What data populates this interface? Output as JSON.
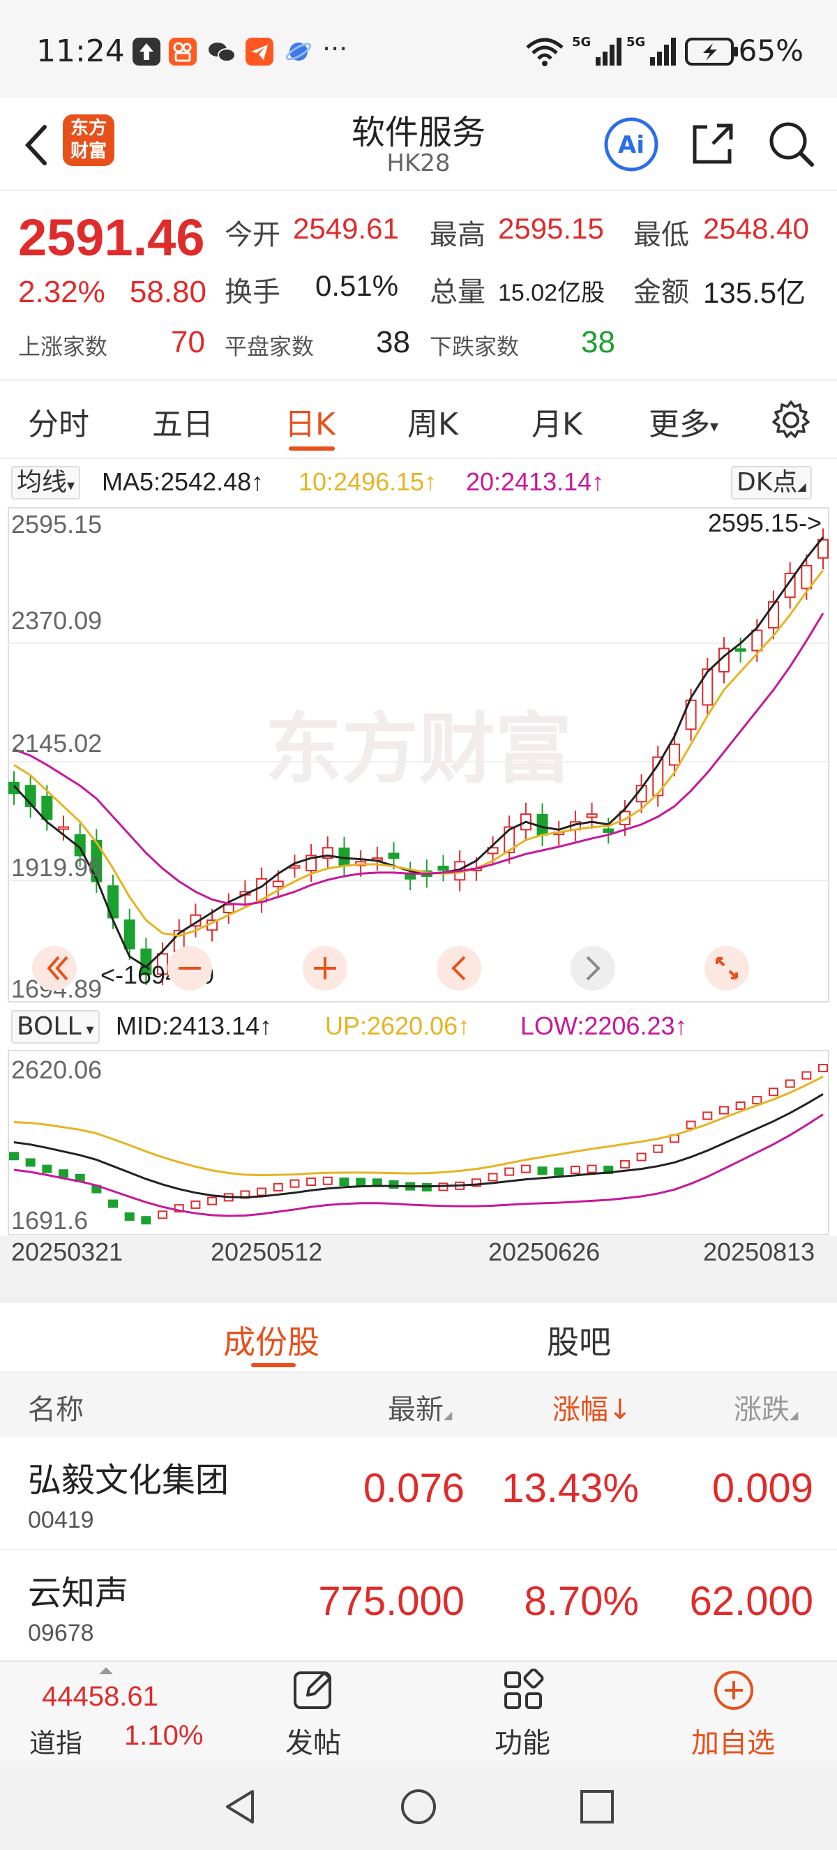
{
  "status": {
    "time": "11:24",
    "right_text": "65%",
    "more": "···"
  },
  "header": {
    "brand": "东方财富",
    "brand_line1": "东方",
    "brand_line2": "财富",
    "title": "软件服务",
    "subtitle": "HK28",
    "ai_label": "Ai"
  },
  "quote": {
    "price": "2591.46",
    "change_pct": "2.32%",
    "change_amt": "58.80",
    "open_label": "今开",
    "open": "2549.61",
    "high_label": "最高",
    "high": "2595.15",
    "low_label": "最低",
    "low": "2548.40",
    "turnover_label": "换手",
    "turnover": "0.51%",
    "volume_label": "总量",
    "volume": "15.02亿股",
    "amount_label": "金额",
    "amount": "135.5亿",
    "up_label": "上涨家数",
    "up_count": "70",
    "flat_label": "平盘家数",
    "flat_count": "38",
    "down_label": "下跌家数",
    "down_count": "38"
  },
  "tabs": [
    "分时",
    "五日",
    "日K",
    "周K",
    "月K",
    "更多"
  ],
  "active_tab": "日K",
  "ma": {
    "selector": "均线",
    "ma5": "MA5:2542.48↑",
    "ma10": "10:2496.15↑",
    "ma20": "20:2413.14↑",
    "dk_button": "DK点"
  },
  "colors": {
    "up": "#e02b2b",
    "down": "#1aa12e",
    "accent": "#e8501b",
    "ma5": "#222222",
    "ma10": "#e6b422",
    "ma20": "#c8179a"
  },
  "chart_data": [
    {
      "type": "candlestick",
      "y_ticks": [
        "2595.15",
        "2370.09",
        "2145.02",
        "1919.96",
        "1694.89"
      ],
      "ylim": [
        1694.89,
        2595.15
      ],
      "max_marker": "2595.15->",
      "min_marker": "<-1694.89",
      "watermark": "东方财富",
      "series": [
        {
          "name": "MA5",
          "values": [
            2080,
            2045,
            2010,
            1985,
            1960,
            1900,
            1820,
            1750,
            1730,
            1760,
            1795,
            1815,
            1835,
            1855,
            1870,
            1885,
            1910,
            1930,
            1940,
            1945,
            1940,
            1938,
            1935,
            1925,
            1915,
            1910,
            1912,
            1918,
            1935,
            1965,
            1995,
            2010,
            2000,
            1995,
            2005,
            2010,
            2005,
            2035,
            2075,
            2120,
            2175,
            2250,
            2300,
            2330,
            2355,
            2385,
            2430,
            2475,
            2520,
            2560
          ]
        },
        {
          "name": "10",
          "values": [
            2120,
            2100,
            2070,
            2040,
            2010,
            1970,
            1920,
            1865,
            1820,
            1795,
            1790,
            1800,
            1815,
            1830,
            1845,
            1860,
            1878,
            1895,
            1910,
            1920,
            1925,
            1928,
            1928,
            1924,
            1918,
            1912,
            1910,
            1912,
            1920,
            1935,
            1955,
            1975,
            1985,
            1990,
            1995,
            2000,
            2002,
            2015,
            2035,
            2065,
            2105,
            2160,
            2215,
            2265,
            2300,
            2335,
            2370,
            2410,
            2455,
            2496
          ]
        },
        {
          "name": "20",
          "values": [
            2150,
            2138,
            2120,
            2100,
            2080,
            2055,
            2020,
            1985,
            1950,
            1920,
            1895,
            1875,
            1860,
            1852,
            1850,
            1855,
            1865,
            1875,
            1888,
            1898,
            1905,
            1910,
            1912,
            1912,
            1910,
            1910,
            1912,
            1915,
            1920,
            1928,
            1938,
            1948,
            1955,
            1962,
            1970,
            1978,
            1985,
            1995,
            2005,
            2020,
            2040,
            2070,
            2105,
            2145,
            2185,
            2225,
            2265,
            2310,
            2360,
            2413
          ]
        }
      ]
    },
    {
      "type": "bollinger",
      "selector": "BOLL",
      "mid": "MID:2413.14↑",
      "up": "UP:2620.06↑",
      "low": "LOW:2206.23↑",
      "y_ticks": [
        "2620.06",
        "1691.6"
      ],
      "x_ticks": [
        "20250321",
        "20250512",
        "20250626",
        "20250813"
      ]
    }
  ],
  "sub_tabs": [
    "成份股",
    "股吧"
  ],
  "table": {
    "headers": {
      "name": "名称",
      "latest": "最新",
      "change_pct": "涨幅↓",
      "change": "涨跌"
    },
    "rows": [
      {
        "name": "弘毅文化集团",
        "code": "00419",
        "latest": "0.076",
        "change_pct": "13.43%",
        "change": "0.009"
      },
      {
        "name": "云知声",
        "code": "09678",
        "latest": "775.000",
        "change_pct": "8.70%",
        "change": "62.000"
      }
    ]
  },
  "bottom_nav": {
    "index_value": "44458.61",
    "index_name": "道指",
    "index_pct": "1.10%",
    "post": "发帖",
    "features": "功能",
    "add_watch": "加自选"
  }
}
